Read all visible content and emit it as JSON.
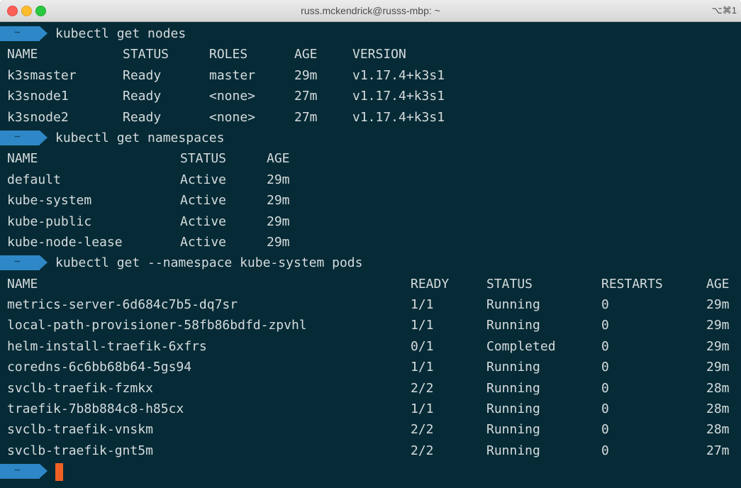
{
  "window": {
    "title": "russ.mckendrick@russs-mbp: ~",
    "shortcut": "⌥⌘1"
  },
  "prompt": {
    "symbol": "~",
    "color": "#2e88c7"
  },
  "colors": {
    "background": "#062b36",
    "text": "#d5dbdd",
    "cursor": "#f05f24"
  },
  "commands": {
    "nodes": "kubectl get nodes",
    "namespaces": "kubectl get namespaces",
    "pods": "kubectl get --namespace kube-system pods"
  },
  "nodes": {
    "headers": [
      "NAME",
      "STATUS",
      "ROLES",
      "AGE",
      "VERSION"
    ],
    "rows": [
      [
        "k3smaster",
        "Ready",
        "master",
        "29m",
        "v1.17.4+k3s1"
      ],
      [
        "k3snode1",
        "Ready",
        "<none>",
        "27m",
        "v1.17.4+k3s1"
      ],
      [
        "k3snode2",
        "Ready",
        "<none>",
        "27m",
        "v1.17.4+k3s1"
      ]
    ]
  },
  "namespaces": {
    "headers": [
      "NAME",
      "STATUS",
      "AGE"
    ],
    "rows": [
      [
        "default",
        "Active",
        "29m"
      ],
      [
        "kube-system",
        "Active",
        "29m"
      ],
      [
        "kube-public",
        "Active",
        "29m"
      ],
      [
        "kube-node-lease",
        "Active",
        "29m"
      ]
    ]
  },
  "pods": {
    "headers": [
      "NAME",
      "READY",
      "STATUS",
      "RESTARTS",
      "AGE"
    ],
    "rows": [
      [
        "metrics-server-6d684c7b5-dq7sr",
        "1/1",
        "Running",
        "0",
        "29m"
      ],
      [
        "local-path-provisioner-58fb86bdfd-zpvhl",
        "1/1",
        "Running",
        "0",
        "29m"
      ],
      [
        "helm-install-traefik-6xfrs",
        "0/1",
        "Completed",
        "0",
        "29m"
      ],
      [
        "coredns-6c6bb68b64-5gs94",
        "1/1",
        "Running",
        "0",
        "29m"
      ],
      [
        "svclb-traefik-fzmkx",
        "2/2",
        "Running",
        "0",
        "28m"
      ],
      [
        "traefik-7b8b884c8-h85cx",
        "1/1",
        "Running",
        "0",
        "28m"
      ],
      [
        "svclb-traefik-vnskm",
        "2/2",
        "Running",
        "0",
        "28m"
      ],
      [
        "svclb-traefik-gnt5m",
        "2/2",
        "Running",
        "0",
        "27m"
      ]
    ]
  }
}
